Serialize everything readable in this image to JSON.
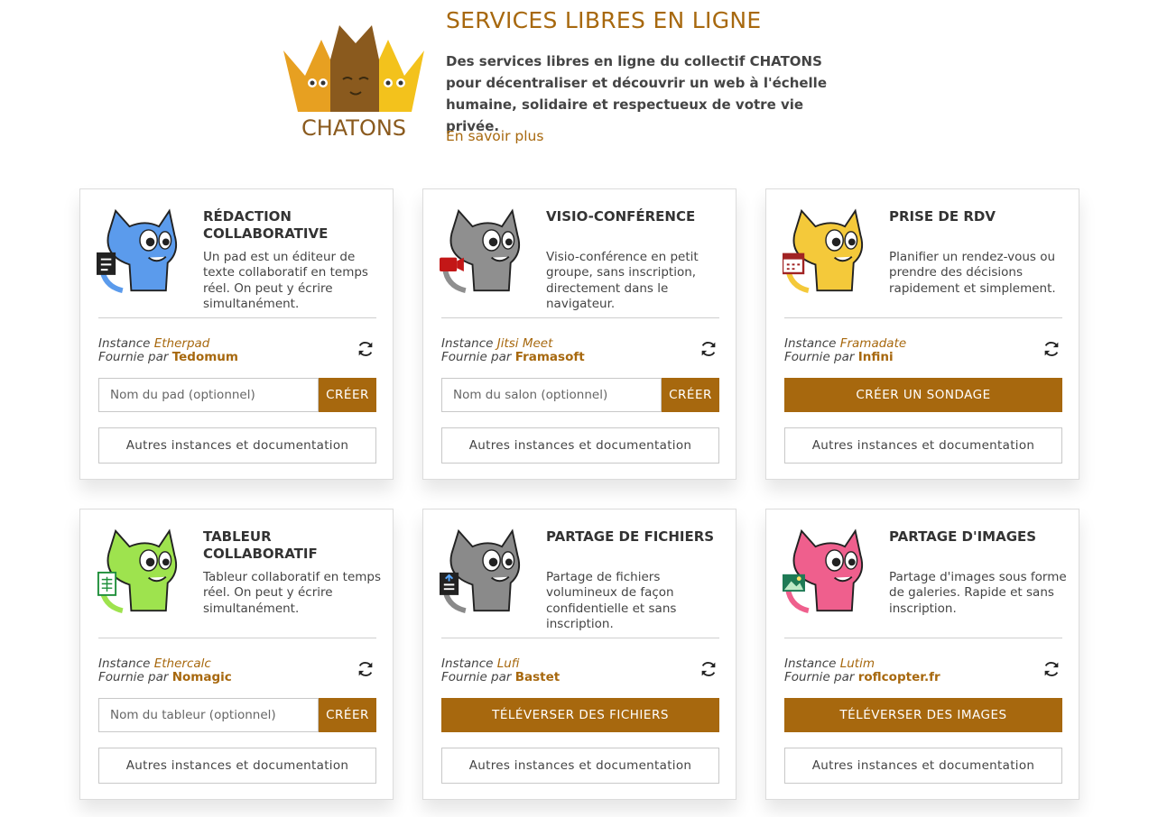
{
  "header": {
    "logo_text": "CHATONS",
    "title": "SERVICES LIBRES EN LIGNE",
    "description": "Des services libres en ligne du collectif CHATONS pour décentraliser et découvrir un web à l'échelle humaine, solidaire et respectueux de votre vie privée.",
    "more_link": "En savoir plus"
  },
  "colors": {
    "accent": "#a7680e",
    "text": "#444444",
    "border": "#dcdcdc"
  },
  "instance_label": "Instance",
  "provider_label": "Fournie par",
  "services": [
    {
      "title": "RÉDACTION COLLABORATIVE",
      "description": "Un pad est un éditeur de texte collaboratif en temps réel. On peut y écrire simultanément.",
      "instance": "Etherpad",
      "provider": "Tedomum",
      "placeholder": "Nom du pad (optionnel)",
      "action": "CRÉER",
      "other": "Autres instances et documentation",
      "icon": "document-edit-icon",
      "cat_color": "#5b9bec"
    },
    {
      "title": "VISIO-CONFÉRENCE",
      "description": "Visio-conférence en petit groupe, sans inscription, directement dans le navigateur.",
      "instance": "Jitsi Meet",
      "provider": "Framasoft",
      "placeholder": "Nom du salon (optionnel)",
      "action": "CRÉER",
      "other": "Autres instances et documentation",
      "icon": "video-camera-icon",
      "cat_color": "#8f8f8f"
    },
    {
      "title": "PRISE DE RDV",
      "description": "Planifier un rendez-vous ou prendre des décisions rapidement et simplement.",
      "instance": "Framadate",
      "provider": "Infini",
      "action": "CRÉER UN SONDAGE",
      "other": "Autres instances et documentation",
      "icon": "calendar-icon",
      "cat_color": "#f4c93a"
    },
    {
      "title": "TABLEUR COLLABORATIF",
      "description": "Tableur collaboratif en temps réel. On peut y écrire simultanément.",
      "instance": "Ethercalc",
      "provider": "Nomagic",
      "placeholder": "Nom du tableur (optionnel)",
      "action": "CRÉER",
      "other": "Autres instances et documentation",
      "icon": "spreadsheet-icon",
      "cat_color": "#9ee34e"
    },
    {
      "title": "PARTAGE DE FICHIERS",
      "description": "Partage de fichiers volumineux de façon confidentielle et sans inscription.",
      "instance": "Lufi",
      "provider": "Bastet",
      "action": "TÉLÉVERSER DES FICHIERS",
      "other": "Autres instances et documentation",
      "icon": "file-upload-icon",
      "cat_color": "#8a8a8a"
    },
    {
      "title": "PARTAGE D'IMAGES",
      "description": "Partage d'images sous forme de galeries. Rapide et sans inscription.",
      "instance": "Lutim",
      "provider": "roflcopter.fr",
      "action": "TÉLÉVERSER DES IMAGES",
      "other": "Autres instances et documentation",
      "icon": "image-icon",
      "cat_color": "#ef5f8d"
    }
  ]
}
